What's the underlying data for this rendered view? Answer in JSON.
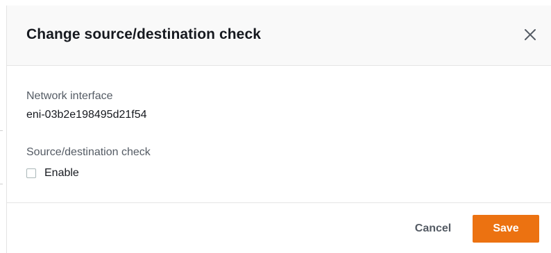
{
  "modal": {
    "title": "Change source/destination check",
    "close_icon": "close-icon"
  },
  "fields": {
    "network_interface": {
      "label": "Network interface",
      "value": "eni-03b2e198495d21f54"
    },
    "source_destination_check": {
      "label": "Source/destination check",
      "checkbox_label": "Enable",
      "checked": false
    }
  },
  "footer": {
    "cancel_label": "Cancel",
    "save_label": "Save"
  },
  "colors": {
    "primary_button": "#ec7211",
    "header_background": "#f9f9f9",
    "text_primary": "#16191f",
    "text_secondary": "#545b64"
  }
}
